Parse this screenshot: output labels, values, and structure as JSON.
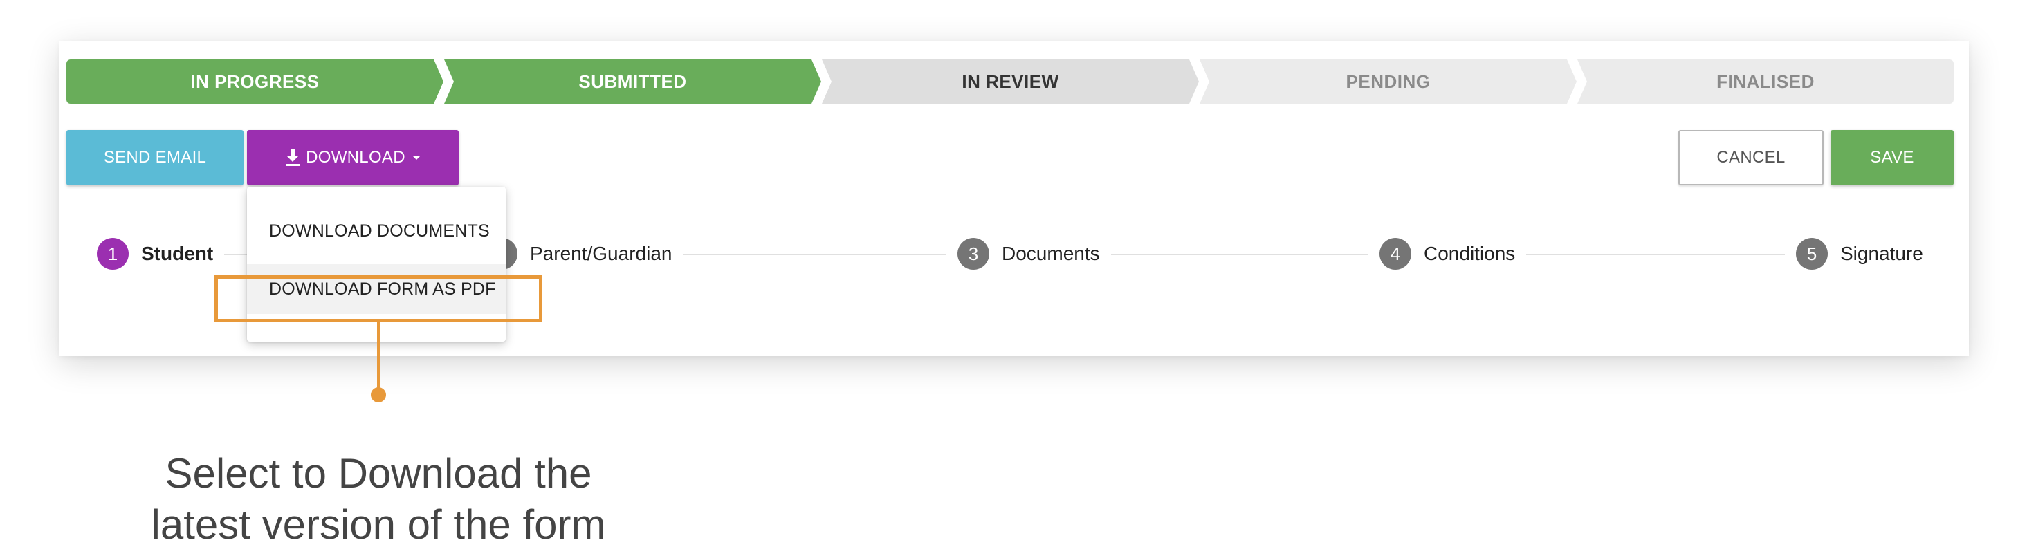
{
  "pipeline": {
    "stages": [
      {
        "label": "IN PROGRESS",
        "state": "done"
      },
      {
        "label": "SUBMITTED",
        "state": "done"
      },
      {
        "label": "IN REVIEW",
        "state": "current"
      },
      {
        "label": "PENDING",
        "state": "todo"
      },
      {
        "label": "FINALISED",
        "state": "todo"
      }
    ]
  },
  "toolbar": {
    "send_email_label": "SEND EMAIL",
    "download_label": "DOWNLOAD",
    "cancel_label": "CANCEL",
    "save_label": "SAVE"
  },
  "download_menu": {
    "items": [
      {
        "label": "DOWNLOAD DOCUMENTS"
      },
      {
        "label": "DOWNLOAD FORM AS PDF"
      }
    ]
  },
  "stepper": {
    "steps": [
      {
        "number": "1",
        "label": "Student",
        "active": true
      },
      {
        "number": "2",
        "label": "Parent/Guardian",
        "active": false
      },
      {
        "number": "3",
        "label": "Documents",
        "active": false
      },
      {
        "number": "4",
        "label": "Conditions",
        "active": false
      },
      {
        "number": "5",
        "label": "Signature",
        "active": false
      }
    ]
  },
  "annotation": {
    "line1": "Select to Download the",
    "line2": "latest version of the form"
  },
  "colors": {
    "done": "#69ad5a",
    "primary_purple": "#9b2fb0",
    "email_blue": "#5bbbd6",
    "annotation_orange": "#e8993a",
    "step_grey": "#757575"
  },
  "icons": {
    "download": "download-icon",
    "caret": "caret-down-icon"
  }
}
